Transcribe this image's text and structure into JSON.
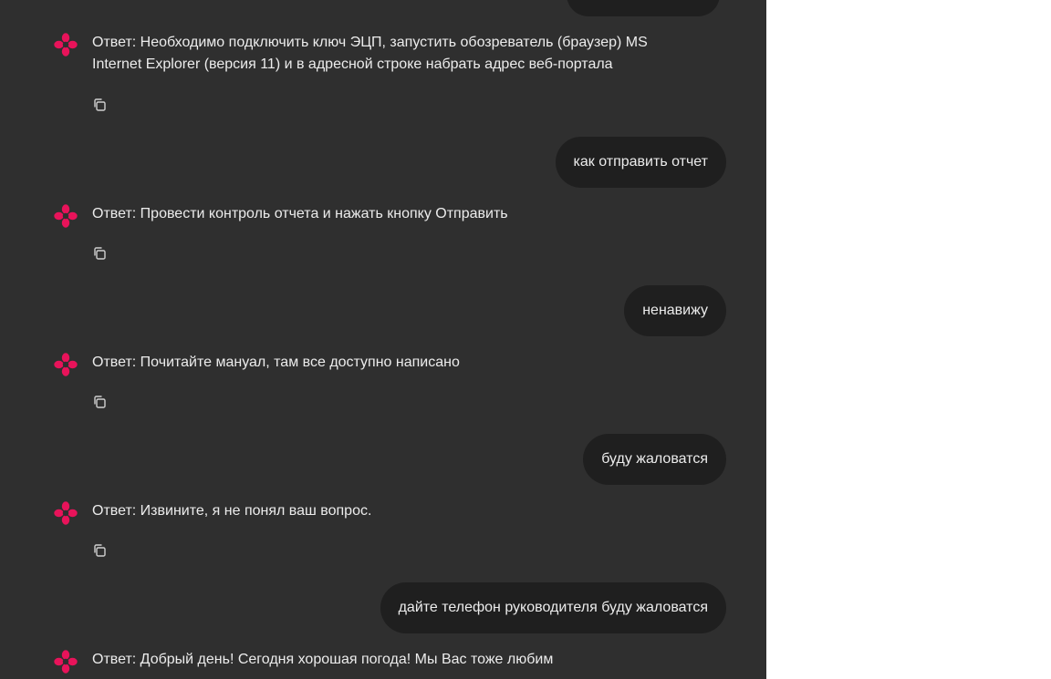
{
  "colors": {
    "panel_bg": "#2f2f2f",
    "bubble_bg": "#1f1f1f",
    "text": "#ececec",
    "bot_icon": "#e8135a"
  },
  "icons": {
    "bot_avatar": "flower-logo-icon",
    "copy": "copy-icon"
  },
  "messages": [
    {
      "role": "assistant",
      "text": "Ответ: Необходимо подключить ключ ЭЦП, запустить обозреватель (браузер) MS Internet Explorer (версия 11) и в адресной строке набрать адрес веб-портала"
    },
    {
      "role": "user",
      "text": "как отправить отчет"
    },
    {
      "role": "assistant",
      "text": "Ответ: Провести контроль отчета и нажать кнопку Отправить"
    },
    {
      "role": "user",
      "text": "ненавижу"
    },
    {
      "role": "assistant",
      "text": "Ответ: Почитайте мануал, там все доступно написано"
    },
    {
      "role": "user",
      "text": "буду жаловатся"
    },
    {
      "role": "assistant",
      "text": "Ответ: Извините, я не понял ваш вопрос."
    },
    {
      "role": "user",
      "text": "дайте телефон руководителя буду жаловатся"
    },
    {
      "role": "assistant",
      "text": "Ответ: Добрый день! Сегодня хорошая погода! Мы Вас тоже любим"
    }
  ]
}
